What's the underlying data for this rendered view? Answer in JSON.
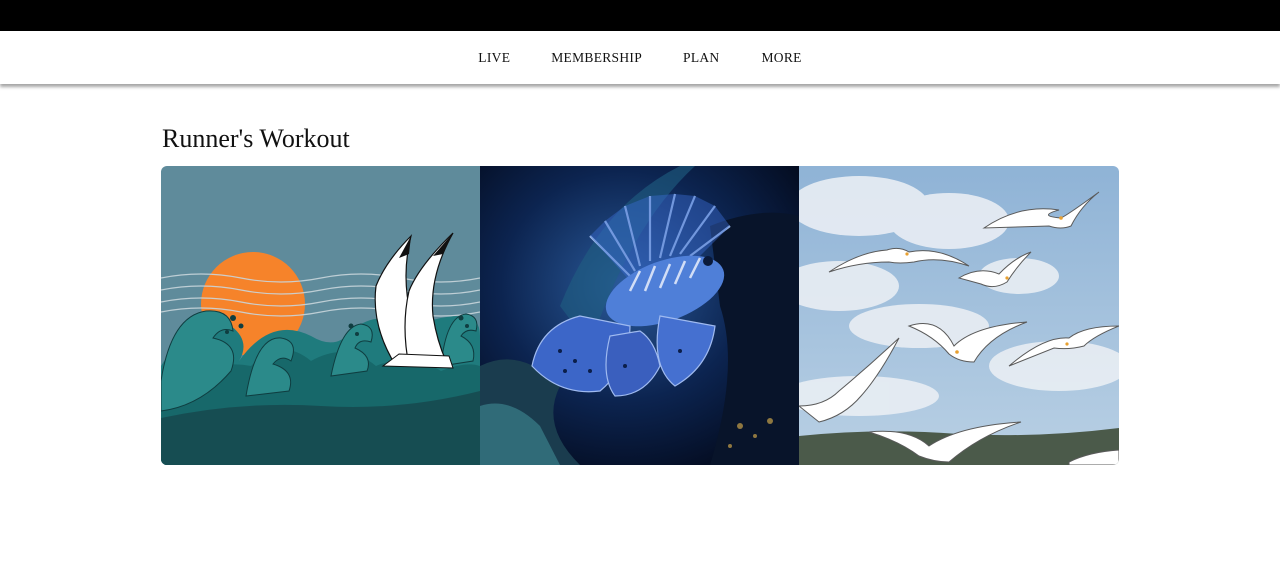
{
  "nav": {
    "items": [
      {
        "label": "LIVE"
      },
      {
        "label": "MEMBERSHIP"
      },
      {
        "label": "PLAN"
      },
      {
        "label": "MORE"
      }
    ]
  },
  "section": {
    "title": "Runner's Workout"
  },
  "gallery": {
    "images": [
      {
        "subject": "waves-sun-birds-illustration"
      },
      {
        "subject": "lionfish-photo"
      },
      {
        "subject": "seagulls-sky-photo"
      }
    ]
  },
  "colors": {
    "top_bar": "#000000",
    "page_background": "#ffffff",
    "text": "#111111"
  }
}
